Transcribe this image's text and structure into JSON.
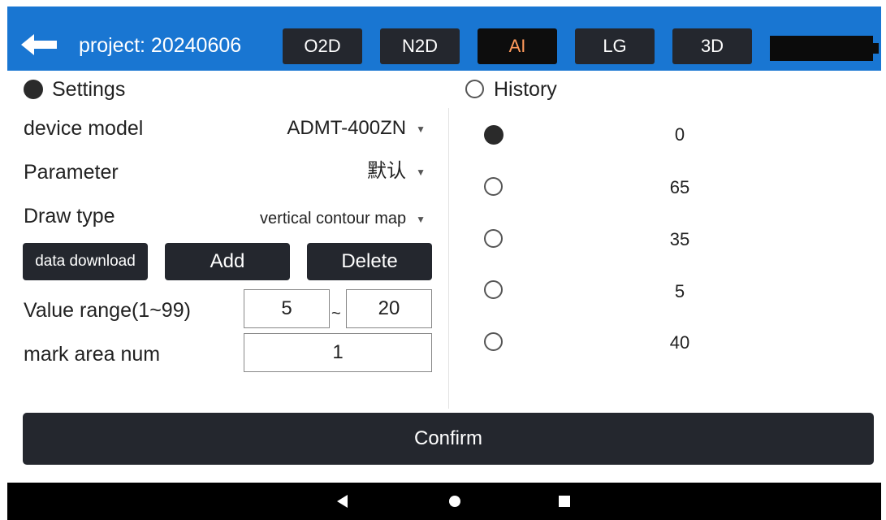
{
  "header": {
    "project_label": "project: 20240606",
    "tabs": [
      {
        "label": "O2D",
        "active": false
      },
      {
        "label": "N2D",
        "active": false
      },
      {
        "label": "AI",
        "active": true
      },
      {
        "label": "LG",
        "active": false
      },
      {
        "label": "3D",
        "active": false
      }
    ],
    "icons": {
      "back": "arrow-left-icon",
      "battery": "battery-icon"
    }
  },
  "settings": {
    "title": "Settings",
    "selected": true,
    "device_model": {
      "label": "device model",
      "value": "ADMT-400ZN"
    },
    "parameter": {
      "label": "Parameter",
      "value": "默认"
    },
    "draw_type": {
      "label": "Draw type",
      "value": "vertical contour map"
    },
    "buttons": {
      "data_download": "data download",
      "add": "Add",
      "delete": "Delete"
    },
    "value_range": {
      "label": "Value range(1~99)",
      "min": "5",
      "separator": "~",
      "max": "20"
    },
    "mark_area": {
      "label": "mark area num",
      "value": "1"
    }
  },
  "history": {
    "title": "History",
    "selected": false,
    "items": [
      {
        "value": "0",
        "selected": true
      },
      {
        "value": "65",
        "selected": false
      },
      {
        "value": "35",
        "selected": false
      },
      {
        "value": "5",
        "selected": false
      },
      {
        "value": "40",
        "selected": false
      }
    ]
  },
  "confirm_label": "Confirm",
  "nav_icons": [
    "nav-back-icon",
    "nav-home-icon",
    "nav-recent-icon"
  ],
  "colors": {
    "header": "#1976d2",
    "button": "#24272e",
    "active_tab_text": "#ff9a5c"
  }
}
